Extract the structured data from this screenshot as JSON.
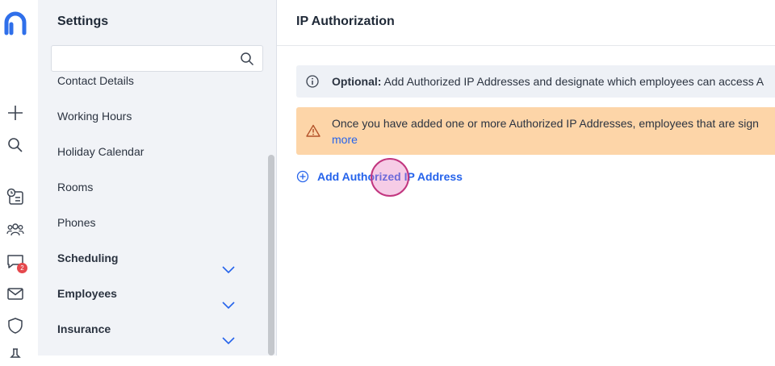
{
  "rail": {
    "chat_badge": "2"
  },
  "sidebar": {
    "title": "Settings",
    "search": {
      "value": "",
      "placeholder": ""
    },
    "items": [
      {
        "label": "Contact Details"
      },
      {
        "label": "Working Hours"
      },
      {
        "label": "Holiday Calendar"
      },
      {
        "label": "Rooms"
      },
      {
        "label": "Phones"
      },
      {
        "label": "Scheduling"
      },
      {
        "label": "Employees"
      },
      {
        "label": "Insurance"
      }
    ]
  },
  "main": {
    "title": "IP Authorization",
    "info": {
      "strong": "Optional:",
      "text": " Add Authorized IP Addresses and designate which employees can access A"
    },
    "warning": {
      "text": "Once you have added one or more Authorized IP Addresses, employees that are sign",
      "link": "more"
    },
    "add_button": "Add Authorized IP Address"
  },
  "colors": {
    "accent": "#2563eb",
    "warning_bg": "#fdd5a8",
    "info_bg": "#eef1f6",
    "sidebar_bg": "#f1f3f7",
    "logo": "#2f6fea",
    "badge": "#e5484d"
  }
}
